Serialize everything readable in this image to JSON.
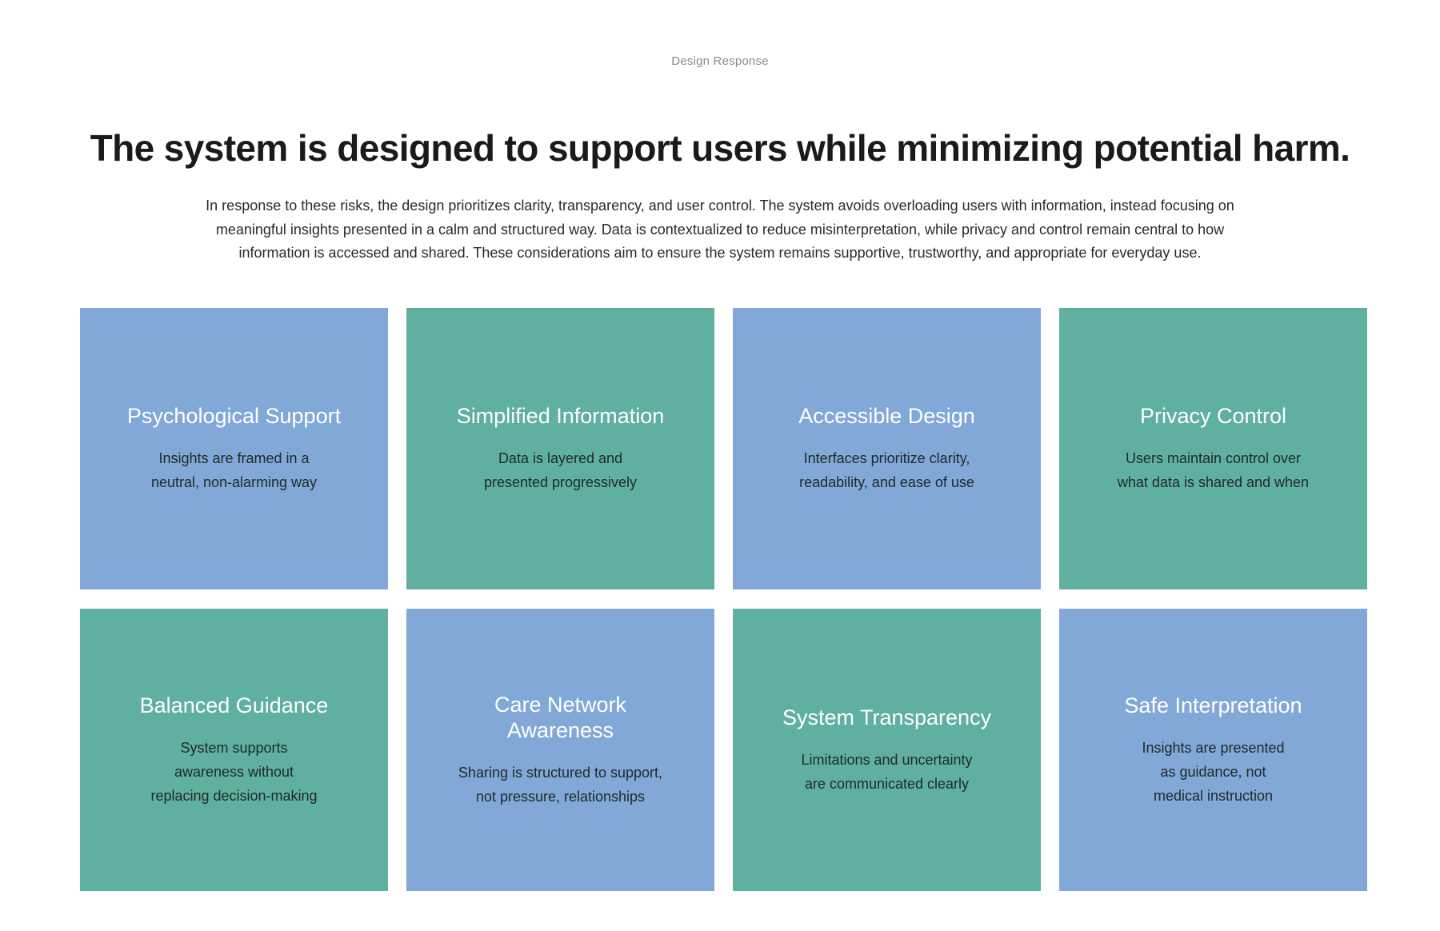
{
  "section": {
    "eyebrow": "Design Response",
    "headline": "The system is designed to support users while minimizing potential harm.",
    "intro": "In response to these risks, the design prioritizes clarity, transparency, and user control. The system avoids overloading users with information, instead focusing on meaningful insights presented in a calm and structured way. Data is contextualized to reduce misinterpretation, while privacy and control remain central to how information is accessed and shared. These considerations aim to ensure the system remains supportive, trustworthy, and appropriate for everyday use."
  },
  "colors": {
    "blue": "#81a8d6",
    "green": "#5fb0a0",
    "title_text": "#ffffff"
  },
  "cards": [
    {
      "title": "Psychological Support",
      "desc_lines": [
        "Insights are framed in a",
        "neutral, non-alarming way"
      ],
      "color": "blue"
    },
    {
      "title": "Simplified Information",
      "desc_lines": [
        "Data is layered and",
        "presented progressively"
      ],
      "color": "green"
    },
    {
      "title": "Accessible Design",
      "desc_lines": [
        "Interfaces prioritize clarity,",
        "readability, and ease of use"
      ],
      "color": "blue"
    },
    {
      "title": "Privacy Control",
      "desc_lines": [
        "Users maintain control over",
        "what data is shared and when"
      ],
      "color": "green"
    },
    {
      "title": "Balanced Guidance",
      "desc_lines": [
        "System supports",
        "awareness without",
        "replacing decision-making"
      ],
      "color": "green"
    },
    {
      "title": "Care Network Awareness",
      "desc_lines": [
        "Sharing is structured to support,",
        "not pressure, relationships"
      ],
      "color": "blue"
    },
    {
      "title": "System Transparency",
      "desc_lines": [
        "Limitations and uncertainty",
        "are communicated clearly"
      ],
      "color": "green"
    },
    {
      "title": "Safe Interpretation",
      "desc_lines": [
        "Insights are presented",
        "as guidance, not",
        "medical instruction"
      ],
      "color": "blue"
    }
  ]
}
